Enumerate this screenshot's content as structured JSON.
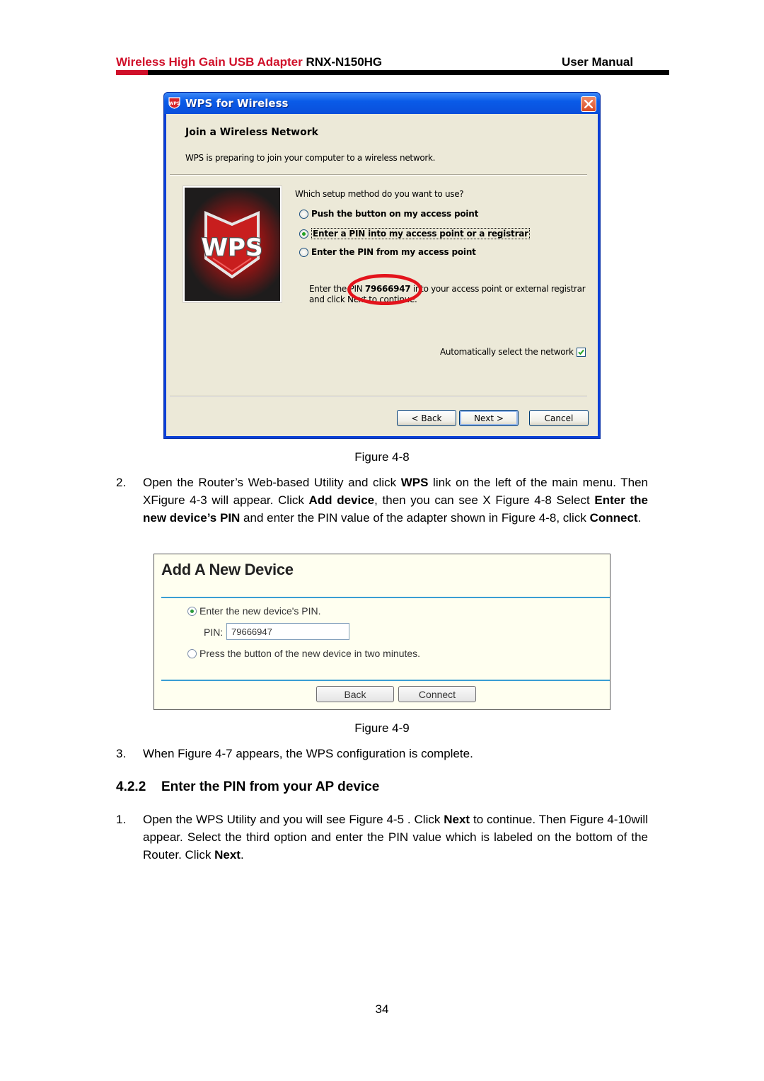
{
  "header": {
    "product_name": "Wireless High Gain USB Adapter",
    "model": "RNX-N150HG",
    "doc_type": "User Manual",
    "accent_color": "#d0102a"
  },
  "figure_4_8": {
    "window_title": "WPS for Wireless",
    "title_icon": "wps-shield-icon",
    "heading": "Join a Wireless Network",
    "subtitle": "WPS is preparing to join your computer to a wireless network.",
    "logo_text": "WPS",
    "question": "Which setup method do you want to use?",
    "options": [
      {
        "label": "Push the button on my access point",
        "selected": false
      },
      {
        "label": "Enter a PIN into my access point or a registrar",
        "selected": true
      },
      {
        "label": "Enter the PIN from my access point",
        "selected": false
      }
    ],
    "pin_prefix": "Enter the PIN",
    "pin_value": "79666947",
    "pin_suffix": "into your access point or external registrar",
    "pin_line2": "and click Next to continue.",
    "auto_select_label": "Automatically select the network",
    "auto_select_checked": true,
    "buttons": {
      "back": "< Back",
      "next": "Next >",
      "cancel": "Cancel"
    },
    "highlight_color": "#e3141c",
    "caption": "Figure 4-8"
  },
  "step2": {
    "number": "2.",
    "t1": "Open the Router’s Web-based Utility and click ",
    "b1": "WPS",
    "t2": " link on the left of the main menu. Then XFigure 4-3 will appear. Click ",
    "b2": "Add device",
    "t3": ", then you can see X Figure 4-8 Select ",
    "b3": "Enter the new device’s PIN",
    "t4": " and enter the PIN value of the adapter shown in Figure 4-8, click ",
    "b4": "Connect",
    "t5": "."
  },
  "figure_4_9": {
    "title": "Add A New Device",
    "option1": "Enter the new device's PIN.",
    "option1_selected": true,
    "pin_label": "PIN:",
    "pin_value": "79666947",
    "option2": "Press the button of the new device in two minutes.",
    "option2_selected": false,
    "buttons": {
      "back": "Back",
      "connect": "Connect"
    },
    "divider_color": "#3a9ed4",
    "caption": "Figure 4-9"
  },
  "step3": {
    "number": "3.",
    "text": "When Figure 4-7 appears, the WPS configuration is complete."
  },
  "section": {
    "number": "4.2.2",
    "title": "Enter the PIN from your AP device"
  },
  "section_step1": {
    "number": "1.",
    "t1": "Open the WPS Utility and you will see Figure 4-5 . Click ",
    "b1": "Next",
    "t2": " to continue. Then Figure 4-10will appear. Select the third option and enter the PIN value which is labeled on the bottom of the Router. Click ",
    "b2": "Next",
    "t3": "."
  },
  "page_number": "34"
}
